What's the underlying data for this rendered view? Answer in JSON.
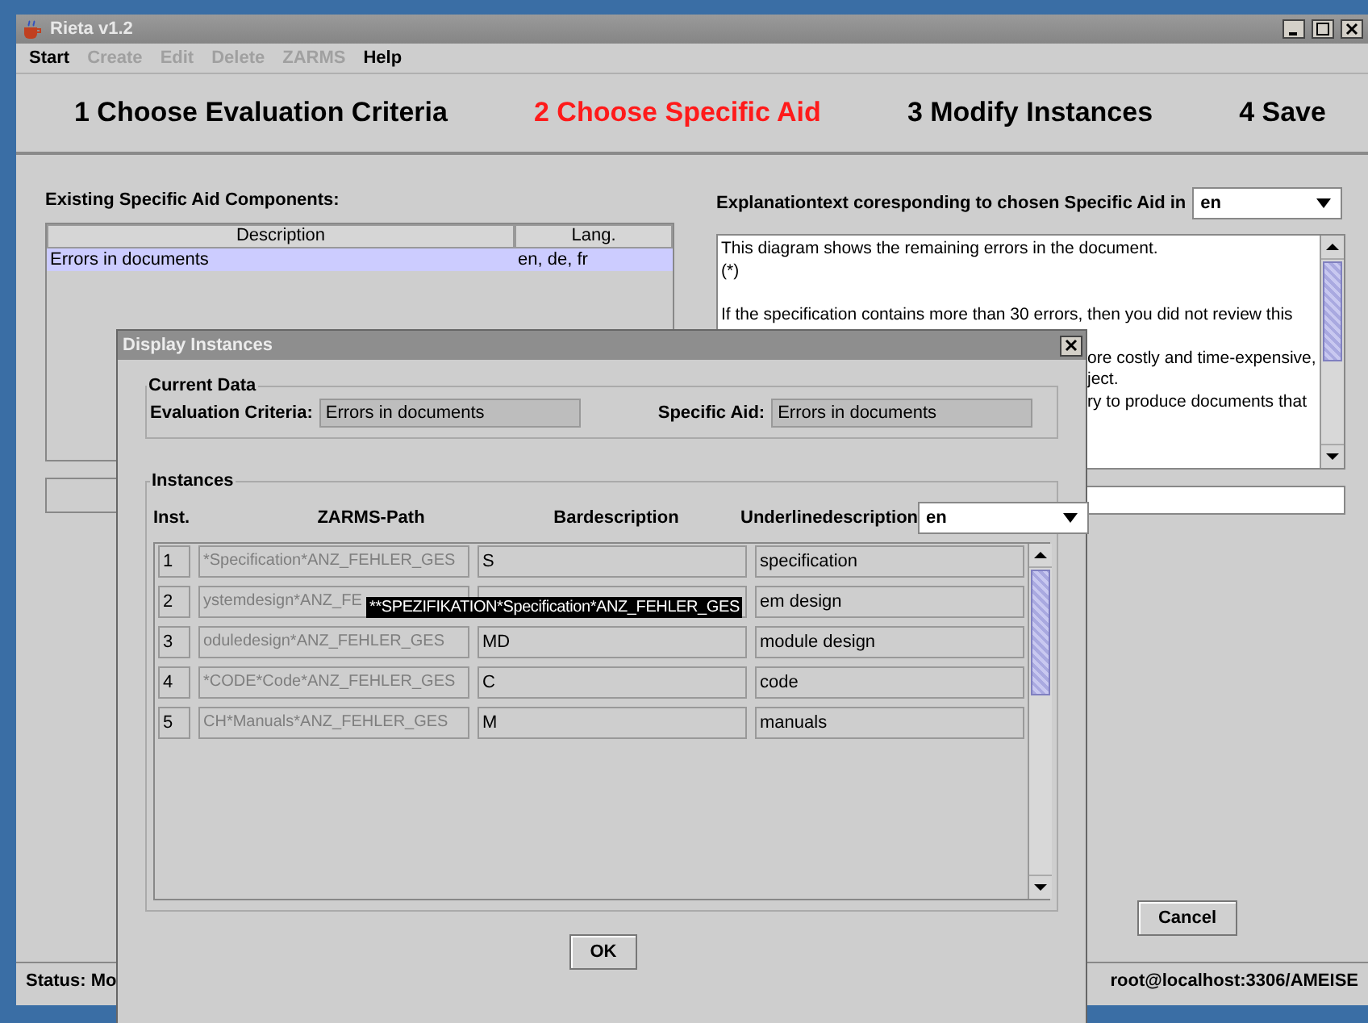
{
  "main_window": {
    "title": "Rieta v1.2",
    "menu": [
      {
        "label": "Start",
        "disabled": false
      },
      {
        "label": "Create",
        "disabled": true
      },
      {
        "label": "Edit",
        "disabled": true
      },
      {
        "label": "Delete",
        "disabled": true
      },
      {
        "label": "ZARMS",
        "disabled": true
      },
      {
        "label": "Help",
        "disabled": false
      }
    ],
    "steps": [
      {
        "label": "1 Choose Evaluation Criteria",
        "selected": false
      },
      {
        "label": "2 Choose Specific Aid",
        "selected": true
      },
      {
        "label": "3 Modify Instances",
        "selected": false
      },
      {
        "label": "4 Save",
        "selected": false
      }
    ],
    "components": {
      "title": "Existing Specific Aid Components:",
      "columns": [
        "Description",
        "Lang."
      ],
      "rows": [
        {
          "cells": [
            "Errors in documents",
            "en, de, fr"
          ],
          "selected": true
        }
      ]
    },
    "explanation": {
      "label": "Explanationtext coresponding to chosen Specific Aid in",
      "language": "en",
      "lines": [
        {
          "text": "This diagram shows the remaining errors in the document.",
          "kind": "full"
        },
        {
          "text": "(*)",
          "kind": "full"
        },
        {
          "text": "If the specification contains more than 30 errors, then you did not review this",
          "kind": "full_after_gap"
        },
        {
          "text": "ore costly and time-expensive,",
          "kind": "fragment_after_gap"
        },
        {
          "text": "ject.",
          "kind": "fragment"
        },
        {
          "text": "ry to produce documents that",
          "kind": "fragment"
        }
      ]
    },
    "cancel": "Cancel",
    "status": {
      "left": "Status: Mo",
      "right": "root@localhost:3306/AMEISE"
    }
  },
  "dialog": {
    "title": "Display Instances",
    "current_data": {
      "title": "Current Data",
      "evaluation_criteria_label": "Evaluation Criteria:",
      "evaluation_criteria": "Errors in documents",
      "specific_aid_label": "Specific Aid:",
      "specific_aid": "Errors in documents"
    },
    "instances": {
      "title": "Instances",
      "columns": [
        "Inst.",
        "ZARMS-Path",
        "Bardescription",
        "Underlinedescription"
      ],
      "language": "en",
      "rows": [
        {
          "inst": "1",
          "path": "*Specification*ANZ_FEHLER_GES",
          "path_disabled": true,
          "bar": "S",
          "underline": "specification"
        },
        {
          "inst": "2",
          "path": "ystemdesign*ANZ_FE",
          "path_disabled": true,
          "underline": "em design"
        },
        {
          "inst": "3",
          "path": "oduledesign*ANZ_FEHLER_GES",
          "path_disabled": true,
          "bar": "MD",
          "underline": "module design"
        },
        {
          "inst": "4",
          "path": "*CODE*Code*ANZ_FEHLER_GES",
          "path_disabled": true,
          "bar": "C",
          "underline": "code"
        },
        {
          "inst": "5",
          "path": "CH*Manuals*ANZ_FEHLER_GES",
          "path_disabled": true,
          "bar": "M",
          "underline": "manuals"
        }
      ]
    },
    "tooltip": "**SPEZIFIKATION*Specification*ANZ_FEHLER_GES",
    "ok": "OK"
  }
}
